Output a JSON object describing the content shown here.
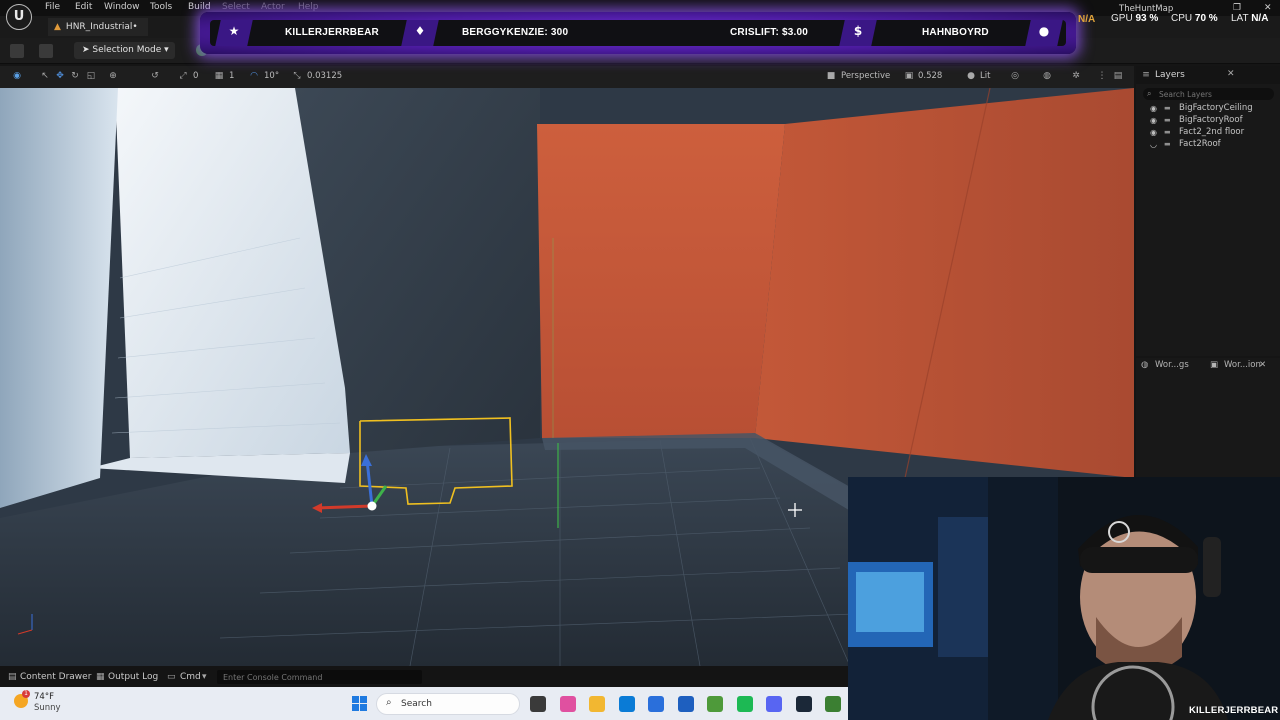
{
  "menu": {
    "items": [
      "File",
      "Edit",
      "Window",
      "Tools",
      "Build",
      "Select",
      "Actor",
      "Help"
    ]
  },
  "document_tab": {
    "label": "HNR_Industrial•"
  },
  "toolbar": {
    "selection_mode": "Selection Mode"
  },
  "viewport_toolbar": {
    "rotate_snap": "0",
    "scale_snap": "1",
    "angle_snap": "10°",
    "grid_value": "0.03125",
    "view_mode": "Perspective",
    "camera_speed": "0.528",
    "lighting": "Lit"
  },
  "layers_panel": {
    "title": "Layers",
    "search_placeholder": "Search Layers",
    "items": [
      {
        "label": "BigFactoryCeiling"
      },
      {
        "label": "BigFactoryRoof"
      },
      {
        "label": "Fact2_2nd floor"
      },
      {
        "label": "Fact2Roof"
      }
    ]
  },
  "secondary_panel": {
    "tabs": [
      "Wor...gs",
      "Wor...ion"
    ]
  },
  "bottom_bar": {
    "content_drawer": "Content Drawer",
    "output_log": "Output Log",
    "cmd": "Cmd",
    "console_placeholder": "Enter Console Command"
  },
  "taskbar": {
    "weather_temp": "74°F",
    "weather_desc": "Sunny",
    "weather_badge": "1",
    "search_label": "Search",
    "app_colors": [
      "#3a3a3a",
      "#e050a0",
      "#f2b731",
      "#0a7bd6",
      "#2a6fdb",
      "#1e5fbf",
      "#4e9a3a",
      "#1db954",
      "#5865f2",
      "#1b2838",
      "#3b7f32"
    ]
  },
  "stream_overlay": {
    "banner": {
      "slot1": "KILLERJERRBEAR",
      "slot2": "BERGGYKENZIE: 300",
      "slot3": "CRISLIFT: $3.00",
      "slot4": "HAHNBOYRD",
      "glyph_star": "★",
      "glyph_diamond": "♦",
      "glyph_dollar": "$",
      "glyph_user": "●"
    },
    "stats": {
      "gpu_label": "GPU",
      "gpu_value": "93 %",
      "cpu_label": "CPU",
      "cpu_value": "70 %",
      "lat_label": "LAT",
      "lat_value": "N/A",
      "left_value": "N/A"
    },
    "map_name": "TheHuntMap",
    "webcam_name": "KILLERJERRBEAR"
  },
  "colors": {
    "accent_purple": "#7a35e6",
    "orange_wall": "#c75a3a",
    "selection_outline": "#f0c020"
  }
}
